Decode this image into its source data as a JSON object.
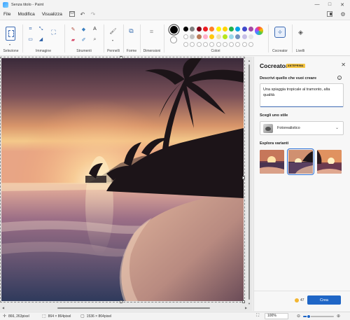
{
  "window": {
    "title": "Senza titolo - Paint",
    "minimize": "—",
    "maximize": "□",
    "close": "✕"
  },
  "menu": {
    "file": "File",
    "edit": "Modifica",
    "view": "Visualizza",
    "save_icon": "save-icon",
    "undo_icon": "undo-icon",
    "redo_icon": "redo-icon",
    "layers_icon": "layers-toggle-icon",
    "settings_icon": "gear-icon"
  },
  "ribbon": {
    "selection": "Selezione",
    "image": "Immagine",
    "tools": "Strumenti",
    "brushes": "Pennelli",
    "shapes": "Forme",
    "size": "Dimensioni",
    "colors": "Colori",
    "cocreator": "Cocreator",
    "layers": "Livelli",
    "primary_color": "#000000",
    "palette_row1": [
      "#000000",
      "#7f7f7f",
      "#880015",
      "#ed1c24",
      "#ff7f27",
      "#fff200",
      "#ffd400",
      "#22b14c",
      "#00a2e8",
      "#3f48cc",
      "#a349a4"
    ],
    "palette_row2": [
      "#ffffff",
      "#c3c3c3",
      "#b97a57",
      "#ffaec9",
      "#ffc90e",
      "#efe4b0",
      "#b5e61d",
      "#99d9ea",
      "#7092be",
      "#c8bfe7",
      "#e6e6e6"
    ]
  },
  "panel": {
    "title": "Cocreator",
    "badge": "ANTEPRIMA",
    "describe_label": "Descrivi quello che vuoi creare",
    "prompt": "Una spiaggia tropicale al tramonto, alta qualità",
    "style_label": "Scegli uno stile",
    "style_value": "Fotorealistico",
    "variants_label": "Esplora varianti",
    "credits": "47",
    "create": "Crea"
  },
  "status": {
    "cursor": "866, 263pixel",
    "selection": "864 × 864pixel",
    "canvas": "1536 × 864pixel",
    "zoom": "100%",
    "zoom_fraction": 0.18
  }
}
